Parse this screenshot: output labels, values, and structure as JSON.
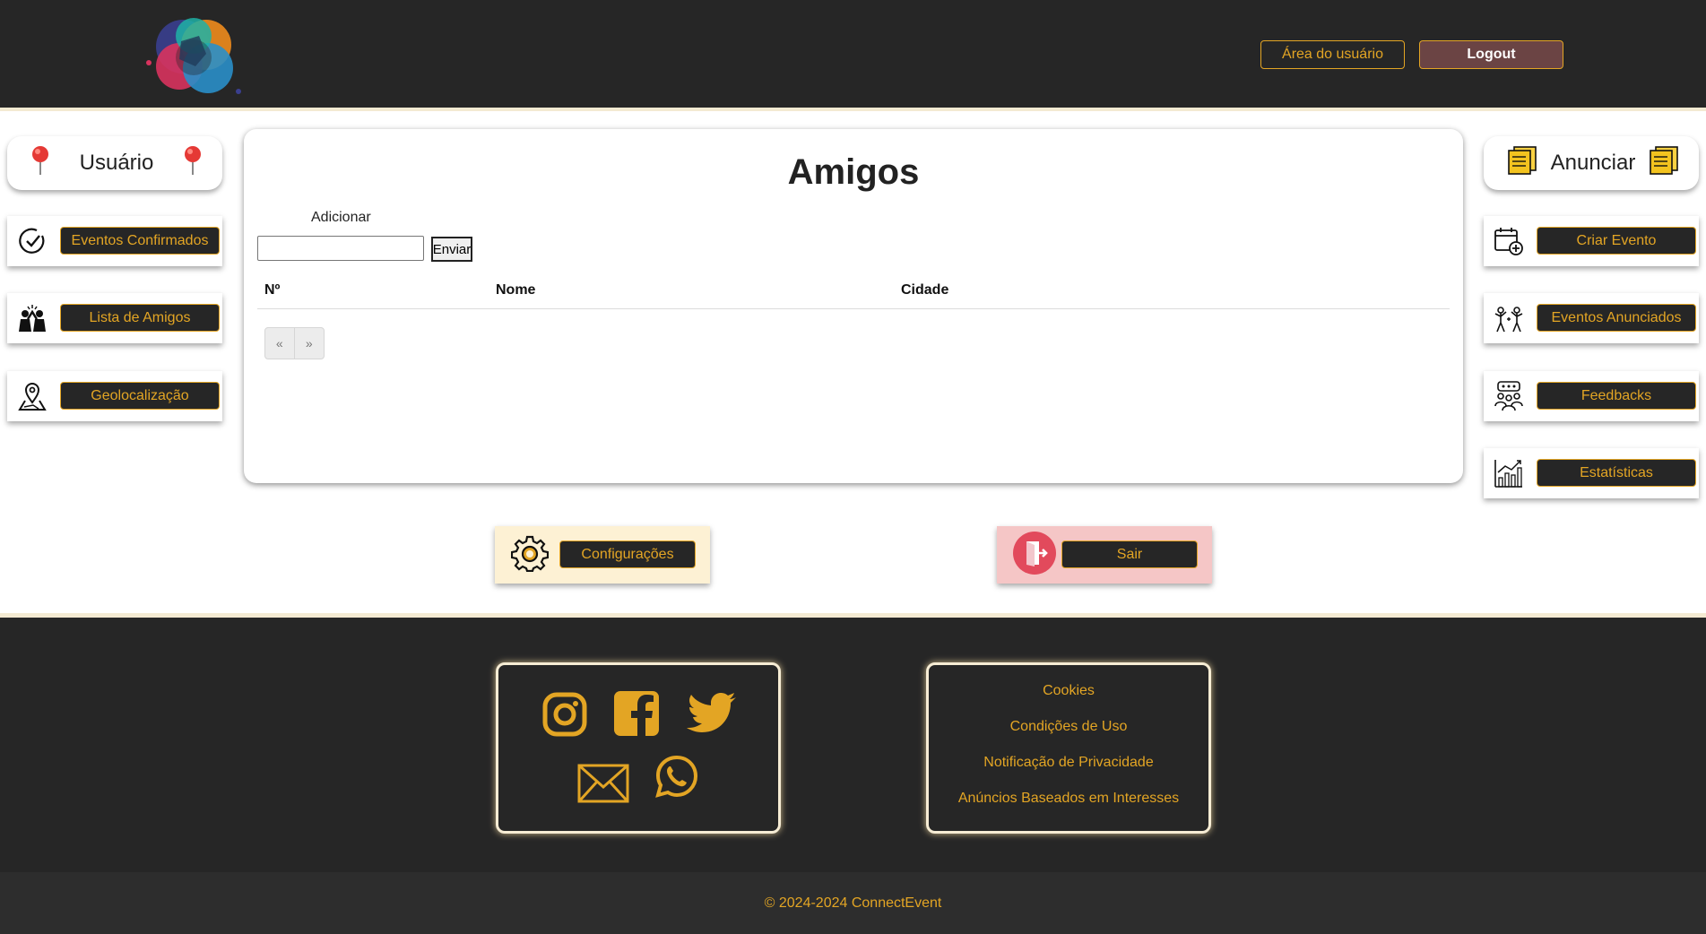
{
  "header": {
    "user_area_label": "Área do usuário",
    "logout_label": "Logout"
  },
  "left_sidebar": {
    "title": "Usuário",
    "items": [
      {
        "label": "Eventos Confirmados",
        "icon": "check-circle-icon"
      },
      {
        "label": "Lista de Amigos",
        "icon": "friends-icon"
      },
      {
        "label": "Geolocalização",
        "icon": "map-pin-icon"
      }
    ]
  },
  "right_sidebar": {
    "title": "Anunciar",
    "items": [
      {
        "label": "Criar Evento",
        "icon": "calendar-add-icon"
      },
      {
        "label": "Eventos Anunciados",
        "icon": "people-celebrate-icon"
      },
      {
        "label": "Feedbacks",
        "icon": "feedback-icon"
      },
      {
        "label": "Estatísticas",
        "icon": "chart-icon"
      }
    ]
  },
  "main": {
    "title": "Amigos",
    "add_label": "Adicionar",
    "add_input_value": "",
    "submit_label": "Enviar",
    "table_headers": [
      "Nº",
      "Nome",
      "Cidade"
    ],
    "pager": {
      "prev": "«",
      "next": "»"
    }
  },
  "actions": {
    "settings_label": "Configurações",
    "exit_label": "Sair"
  },
  "footer": {
    "social": [
      "instagram-icon",
      "facebook-icon",
      "twitter-icon",
      "mail-icon",
      "whatsapp-icon"
    ],
    "links": [
      "Cookies",
      "Condições de Uso",
      "Notificação de Privacidade",
      "Anúncios Baseados em Interesses"
    ],
    "copyright": "© 2024-2024 ConnectEvent"
  },
  "colors": {
    "dark": "#262626",
    "accent": "#e3a524",
    "logout_bg": "#6b4444",
    "settings_bg": "#fdf1d4",
    "exit_bg": "#f5c6c6"
  }
}
